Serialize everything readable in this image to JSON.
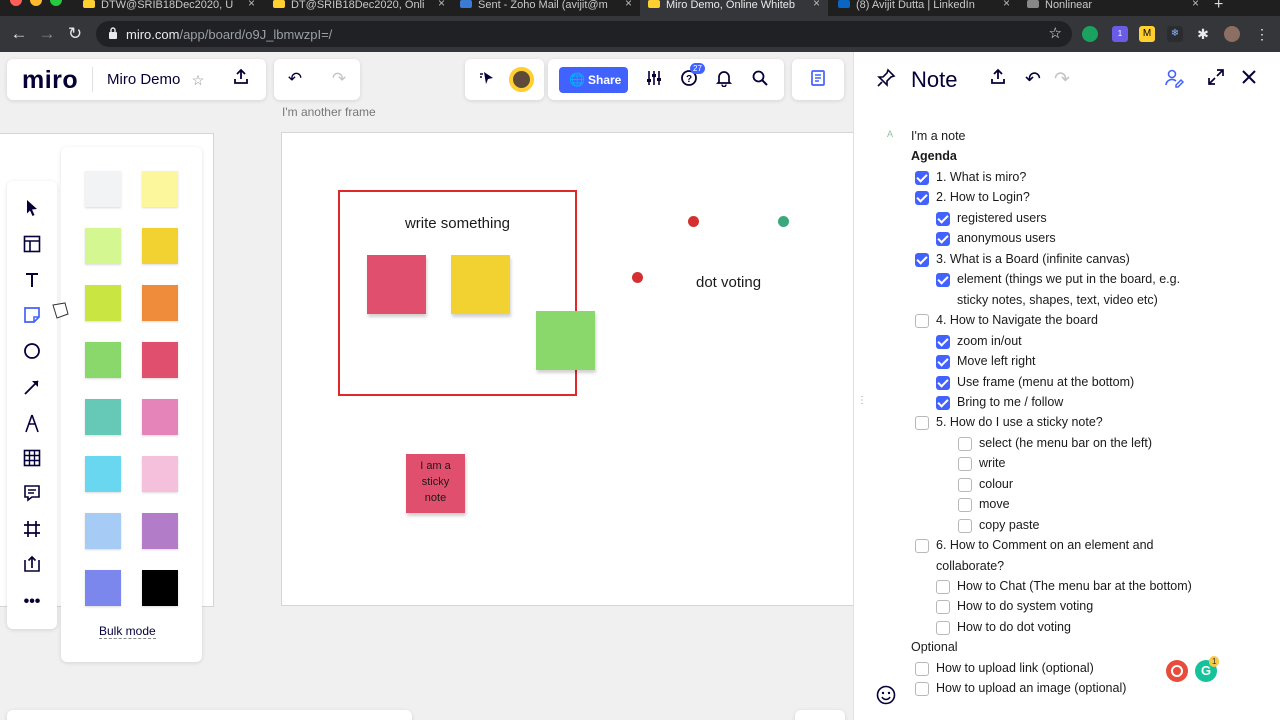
{
  "browser": {
    "tabs": [
      {
        "title": "DTW@SRIB18Dec2020, U",
        "active": false,
        "favicon_color": "#ffd02f"
      },
      {
        "title": "DT@SRIB18Dec2020, Onli",
        "active": false,
        "favicon_color": "#ffd02f"
      },
      {
        "title": "Sent - Zoho Mail (avijit@m",
        "active": false,
        "favicon_color": "#3a7bd5"
      },
      {
        "title": "Miro Demo, Online Whiteb",
        "active": true,
        "favicon_color": "#ffd02f"
      },
      {
        "title": "(8) Avijit Dutta | LinkedIn",
        "active": false,
        "favicon_color": "#0a66c2"
      },
      {
        "title": "Nonlinear",
        "active": false,
        "favicon_color": "#888888"
      }
    ],
    "url_domain": "miro.com",
    "url_path": "/app/board/o9J_lbmwzpI=/",
    "ext_badge": "1"
  },
  "miro": {
    "logo": "miro",
    "board_name": "Miro Demo",
    "share_label": "Share",
    "help_badge": "27",
    "frame_title": "I'm another frame",
    "frame_text": "write something",
    "dot_voting_text": "dot voting",
    "sticky_note_text": "I am a sticky note",
    "bulk_mode": "Bulk mode",
    "colors": {
      "accent": "#4262ff",
      "frame_border": "#e02828",
      "sticky_pink": "#e0506e",
      "sticky_yellow": "#f2d231",
      "sticky_green": "#8ad86b",
      "dot_red": "#d62f2f",
      "dot_green": "#3aa87a"
    },
    "palette": [
      "#f2f3f5",
      "#fcf79d",
      "#d5f791",
      "#f2d231",
      "#c9e541",
      "#ee8c3b",
      "#8ad86b",
      "#e0506e",
      "#66c9b7",
      "#e584b8",
      "#6ad7f0",
      "#f5c0db",
      "#a6ccf5",
      "#b27cc8",
      "#7b87ed",
      "#000000"
    ],
    "tools": [
      "select-icon",
      "templates-icon",
      "text-icon",
      "sticky-note-icon",
      "shape-icon",
      "arrow-icon",
      "pen-icon",
      "table-icon",
      "comment-icon",
      "frame-icon",
      "upload-icon",
      "more-icon"
    ]
  },
  "note": {
    "title": "Note",
    "author_initial": "A",
    "intro": "I'm a note",
    "heading": "Agenda",
    "items": [
      {
        "text": "1. What is miro?",
        "checked": true,
        "level": 1
      },
      {
        "text": "2. How to Login?",
        "checked": true,
        "level": 1
      },
      {
        "text": "registered users",
        "checked": true,
        "level": 2
      },
      {
        "text": "anonymous users",
        "checked": true,
        "level": 2
      },
      {
        "text": "3. What is a Board (infinite canvas)",
        "checked": true,
        "level": 1
      },
      {
        "text": "element (things we put in the board, e.g.",
        "checked": true,
        "level": 2
      },
      {
        "text": "sticky notes, shapes, text, video etc)",
        "checked": null,
        "level": 2
      },
      {
        "text": "4. How to Navigate the board",
        "checked": false,
        "level": 1
      },
      {
        "text": "zoom in/out",
        "checked": true,
        "level": 2
      },
      {
        "text": "Move left right",
        "checked": true,
        "level": 2
      },
      {
        "text": "Use frame (menu at the bottom)",
        "checked": true,
        "level": 2
      },
      {
        "text": "Bring to me / follow",
        "checked": true,
        "level": 2
      },
      {
        "text": "5. How do I use a sticky note?",
        "checked": false,
        "level": 1
      },
      {
        "text": "select (he menu bar on the left)",
        "checked": false,
        "level": 3
      },
      {
        "text": "write",
        "checked": false,
        "level": 3
      },
      {
        "text": "colour",
        "checked": false,
        "level": 3
      },
      {
        "text": "move",
        "checked": false,
        "level": 3
      },
      {
        "text": "copy paste",
        "checked": false,
        "level": 3
      },
      {
        "text": "6. How to Comment on an element and",
        "checked": false,
        "level": 1
      },
      {
        "text": "collaborate?",
        "checked": null,
        "level": 1
      },
      {
        "text": "How to Chat (The menu bar at the bottom)",
        "checked": false,
        "level": 2
      },
      {
        "text": "How to do system voting",
        "checked": false,
        "level": 2
      },
      {
        "text": "How to do dot voting",
        "checked": false,
        "level": 2
      },
      {
        "text": "Optional",
        "checked": null,
        "level": 0
      },
      {
        "text": "How to upload link (optional)",
        "checked": false,
        "level": 1
      },
      {
        "text": "How to upload an image (optional)",
        "checked": false,
        "level": 1
      }
    ],
    "grammarly_badge": "1"
  }
}
